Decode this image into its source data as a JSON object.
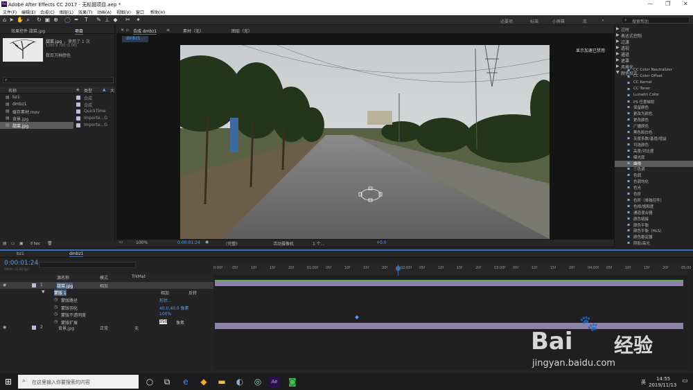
{
  "window": {
    "title": "Adobe After Effects CC 2017 - 无标题项目.aep *",
    "app_icon": "Ae",
    "controls": [
      "—",
      "❐",
      "✕"
    ]
  },
  "menu": [
    "文件(F)",
    "编辑(E)",
    "合成(C)",
    "图层(L)",
    "效果(T)",
    "动画(A)",
    "视图(V)",
    "窗口",
    "帮助(H)"
  ],
  "workspaces": [
    "必要项",
    "标准",
    "小屏幕",
    "库"
  ],
  "help_search": {
    "placeholder": "搜索帮助"
  },
  "project": {
    "tab_effect_controls": "效果控件 甜菜.jpg",
    "tab_project": "项目",
    "selected": {
      "name": "甜菜.jpg",
      "usage": "，使用了 1 次",
      "dims": "1280 x 720 (1.00)",
      "color": "数百万种颜色"
    },
    "columns": {
      "name": "名称",
      "type": "类型",
      "size": "大"
    },
    "items": [
      {
        "name": "bz1",
        "type": "合成",
        "color": "#c6b8d8",
        "selected": false
      },
      {
        "name": "dmbz1",
        "type": "合成",
        "color": "#c6b8d8",
        "selected": false
      },
      {
        "name": "缓存素材.mov",
        "type": "QuickTime",
        "color": "#c6b8d8",
        "selected": false
      },
      {
        "name": "背景.jpg",
        "type": "Importe...G",
        "color": "#c6b8d8",
        "selected": false
      },
      {
        "name": "甜菜.jpg",
        "type": "Importe...G",
        "color": "#c6b8d8",
        "selected": true
      }
    ],
    "bpc": "8 bpc"
  },
  "viewer": {
    "tabs": [
      "合成 dmbz1",
      "素材（无）",
      "图层（无）"
    ],
    "comp_tab": "dmbz1",
    "gpu_notice": "显示加速已禁用",
    "zoom": "100%",
    "timecode": "0:00:01:24",
    "resolution": "(完整)",
    "camera": "活动摄像机",
    "views": "1 个...",
    "exposure": "+0.0"
  },
  "effects": {
    "categories": [
      "过时",
      "表达式控制",
      "过渡",
      "透视",
      "通道",
      "遮罩",
      "风格化",
      "颜色校正"
    ],
    "items": [
      "CC Color Neutralizer",
      "CC Color Offset",
      "CC Kernel",
      "CC Toner",
      "Lumetri Color",
      "PS 任意映射",
      "保留颜色",
      "更改为颜色",
      "更改颜色",
      "广播颜色",
      "黑色和白色",
      "灰度系数/基值/增益",
      "可选颜色",
      "高度/对比度",
      "曝光度",
      "曲线",
      "三色调",
      "色调",
      "色调均化",
      "色光",
      "色阶",
      "色阶（单独控件）",
      "色相/饱和度",
      "通道混合器",
      "颜色链接",
      "颜色平衡",
      "颜色平衡（HLS）",
      "颜色稳定器",
      "阴影/高光"
    ],
    "selected_item": "曲线"
  },
  "timeline": {
    "tabs": [
      "bz1",
      "dmbz1"
    ],
    "timecode": "0:00:01:24",
    "timecode_sub": "00049 (25.00 fps)",
    "columns": {
      "source": "源名称",
      "mode": "模式",
      "trkmat": "TrkMat"
    },
    "ruler": [
      "0:00f",
      "05f",
      "10f",
      "15f",
      "20f",
      "01:00f",
      "05f",
      "10f",
      "15f",
      "20f",
      "02:00f",
      "05f",
      "10f",
      "15f",
      "20f",
      "03:00f",
      "05f",
      "10f",
      "15f",
      "20f",
      "04:00f",
      "05f",
      "10f",
      "15f",
      "20f",
      "05:00"
    ],
    "layers": [
      {
        "num": "1",
        "name": "甜菜.jpg",
        "mode": "相加",
        "selected": true
      },
      {
        "num": "2",
        "name": "背景.jpg",
        "mode": "正常",
        "trkmat": "无"
      }
    ],
    "mask": {
      "name": "蒙版 1",
      "mode": "相加",
      "inverted": "反转",
      "props": [
        {
          "name": "蒙版路径",
          "value": "形状..."
        },
        {
          "name": "蒙版羽化",
          "value": "40.0,40.0 像素"
        },
        {
          "name": "蒙版不透明度",
          "value": "100%"
        },
        {
          "name": "蒙版扩展",
          "value": "350",
          "unit": "像素"
        }
      ]
    }
  },
  "taskbar": {
    "search": "在这里输入你要搜索的内容",
    "time": "14:55",
    "date": "2019/11/13",
    "lang": "英"
  },
  "watermark": {
    "brand": "Bai",
    "brand2": "经验",
    "url": "jingyan.baidu.com"
  }
}
